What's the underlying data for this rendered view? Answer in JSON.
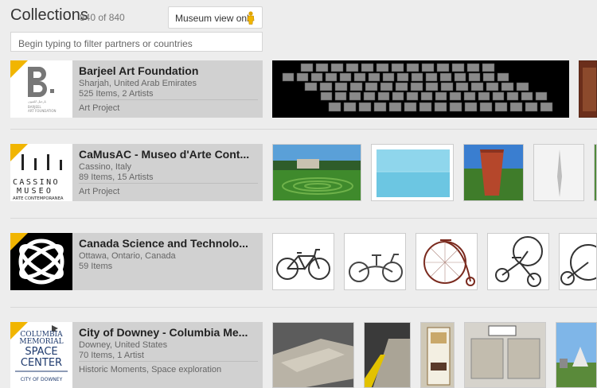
{
  "header": {
    "title": "Collections",
    "count": "840 of 840",
    "museum_view_label": "Museum view only",
    "filter_placeholder": "Begin typing to filter partners or countries"
  },
  "collections": [
    {
      "name": "Barjeel Art Foundation",
      "location": "Sharjah, United Arab Emirates",
      "items": "525 Items, 2 Artists",
      "tags": "Art Project",
      "logo_text": [
        "B",
        "بارجيل للفنون",
        "BARJEEL",
        "ART FOUNDATION"
      ]
    },
    {
      "name": "CaMusAC - Museo d'Arte Cont...",
      "location": "Cassino, Italy",
      "items": "89 Items, 15 Artists",
      "tags": "Art Project",
      "logo_text": [
        "CASSINO",
        "MUSEO",
        "ARTE CONTEMPORANEA"
      ]
    },
    {
      "name": "Canada Science and Technolo...",
      "location": "Ottawa, Ontario, Canada",
      "items": "59 Items",
      "tags": "",
      "logo_text": []
    },
    {
      "name": "City of Downey - Columbia Me...",
      "location": "Downey, United States",
      "items": "70 Items, 1 Artist",
      "tags": "Historic Moments, Space exploration",
      "logo_text": [
        "COLUMBIA",
        "MEMORIAL",
        "SPACE",
        "CENTER",
        "CITY OF DOWNEY"
      ]
    }
  ],
  "colors": {
    "badge": "#f1b500",
    "card_background": "#d1d1d1",
    "page_background": "#ededed"
  }
}
